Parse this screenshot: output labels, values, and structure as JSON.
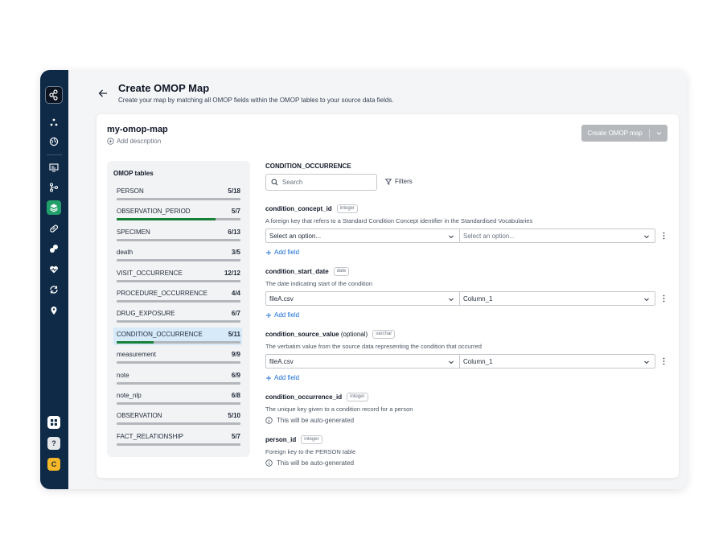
{
  "header": {
    "title": "Create OMOP Map",
    "subtitle": "Create your map by matching all OMOP fields within the OMOP tables to your source data fields."
  },
  "map": {
    "name": "my-omop-map",
    "add_description": "Add description",
    "create_button": "Create  OMOP map"
  },
  "rail": {
    "icons": [
      "network-icon",
      "globe-icon",
      "monitor-icon",
      "git-branch-icon",
      "layers-icon",
      "pill-icon",
      "capsules-icon",
      "heart-icon",
      "sync-icon",
      "location-pin-icon"
    ],
    "help_label": "?",
    "user_initial": "C",
    "active_color": "#22a06b",
    "background": "#0e2a47"
  },
  "tables_panel": {
    "title": "OMOP tables",
    "items": [
      {
        "name": "PERSON",
        "count": "5/18",
        "progress": 0
      },
      {
        "name": "OBSERVATION_PERIOD",
        "count": "5/7",
        "progress": 0.8
      },
      {
        "name": "SPECIMEN",
        "count": "6/13",
        "progress": 0
      },
      {
        "name": "death",
        "count": "3/5",
        "progress": 0
      },
      {
        "name": "VISIT_OCCURRENCE",
        "count": "12/12",
        "progress": 0
      },
      {
        "name": "PROCEDURE_OCCURRENCE",
        "count": "4/4",
        "progress": 0
      },
      {
        "name": "DRUG_EXPOSURE",
        "count": "6/7",
        "progress": 0
      },
      {
        "name": "CONDITION_OCCURRENCE",
        "count": "5/11",
        "progress": 0.3
      },
      {
        "name": "measurement",
        "count": "9/9",
        "progress": 0
      },
      {
        "name": "note",
        "count": "6/9",
        "progress": 0
      },
      {
        "name": "note_nlp",
        "count": "6/8",
        "progress": 0
      },
      {
        "name": "OBSERVATION",
        "count": "5/10",
        "progress": 0
      },
      {
        "name": "FACT_RELATIONSHIP",
        "count": "5/7",
        "progress": 0
      }
    ],
    "selected_index": 7
  },
  "detail": {
    "section_title": "CONDITION_OCCURRENCE",
    "search_placeholder": "Search",
    "filters_label": "Filters",
    "add_field_label": "Add field",
    "auto_generated_label": "This will be auto-generated",
    "fields": [
      {
        "name": "condition_concept_id",
        "optional": "",
        "type": "integer",
        "description": "A foreign key that refers to a Standard Condition Concept identifier in the Standardised Vocabularies",
        "source": "Select an option...",
        "column": "Select an option...",
        "placeholder": true
      },
      {
        "name": "condition_start_date",
        "optional": "",
        "type": "date",
        "description": "The date indicating start of the condition",
        "source": "fileA.csv",
        "column": "Column_1",
        "placeholder": false
      },
      {
        "name": "condition_source_value",
        "optional": "(optional)",
        "type": "varchar",
        "description": "The verbatim value from the source data representing the condition that occurred",
        "source": "fileA.csv",
        "column": "Column_1",
        "placeholder": false
      },
      {
        "name": "condition_occurrence_id",
        "optional": "",
        "type": "integer",
        "description": "The unique key given to a condition record for a person"
      },
      {
        "name": "person_id",
        "optional": "",
        "type": "integer",
        "description": "Foreign key to the PERSON table"
      }
    ]
  }
}
